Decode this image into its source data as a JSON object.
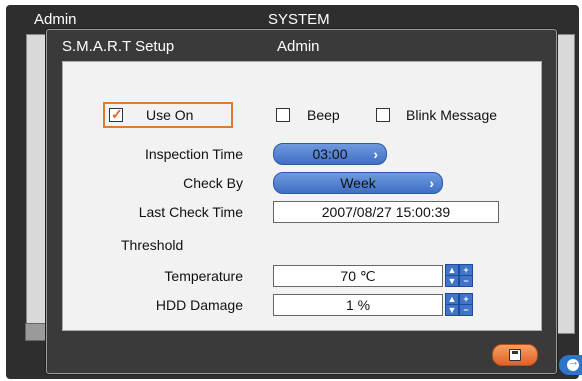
{
  "outer_window": {
    "title_left": "Admin",
    "title_center": "SYSTEM"
  },
  "dialog": {
    "title_left": "S.M.A.R.T Setup",
    "title_center": "Admin",
    "use_on": {
      "label": "Use On",
      "checked": true
    },
    "beep": {
      "label": "Beep",
      "checked": false
    },
    "blink_message": {
      "label": "Blink Message",
      "checked": false
    },
    "inspection_time": {
      "label": "Inspection Time",
      "value": "03:00",
      "chevron": "›"
    },
    "check_by": {
      "label": "Check By",
      "value": "Week",
      "chevron": "›"
    },
    "last_check_time": {
      "label": "Last Check Time",
      "value": "2007/08/27 15:00:39"
    },
    "threshold_label": "Threshold",
    "temperature": {
      "label": "Temperature",
      "value": "70 ℃"
    },
    "hdd_damage": {
      "label": "HDD Damage",
      "value": "1 %"
    },
    "checkmark": "☑",
    "spin_up": "▲",
    "spin_down": "▼",
    "spin_plus": "+",
    "spin_minus": "−"
  },
  "colors": {
    "accent_orange": "#e07a2e",
    "pill_blue": "#4f7fd0",
    "dialog_bg": "#3a3a3a"
  },
  "icons": {
    "save": "floppy-disk-icon",
    "next": "arrow-right-icon"
  }
}
